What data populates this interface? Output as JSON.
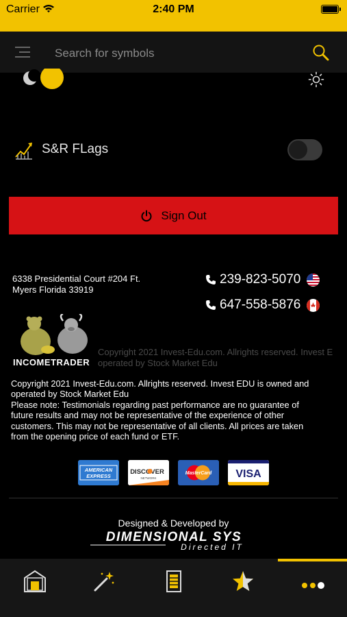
{
  "status_bar": {
    "carrier": "Carrier",
    "time": "2:40 PM"
  },
  "header": {
    "search_placeholder": "Search for symbols"
  },
  "settings": {
    "sr_flags_label": "S&R FLags",
    "sr_flags_enabled": false
  },
  "signout": {
    "label": "Sign Out"
  },
  "contact": {
    "address_line1": "6338 Presidential Court #204 Ft.",
    "address_line2": "Myers Florida 33919",
    "phone_us": "239-823-5070",
    "phone_ca": "647-558-5876"
  },
  "brand": {
    "logo_text": "INCOMETRADER",
    "copyright_faded_line1": "Copyright 2021 Invest-Edu.com. Allrights reserved. Invest E",
    "copyright_faded_line2": "operated by Stock Market Edu"
  },
  "footer": {
    "copyright_line1": "Copyright 2021 Invest-Edu.com. Allrights reserved. Invest EDU is owned and",
    "copyright_line2": "operated by Stock Market Edu",
    "note_line1": "Please note: Testimonials regarding past performance are no guarantee of",
    "note_line2": "future results and may not be representative of the experience of other",
    "note_line3": "customers. This may not be representative of all clients. All prices are taken",
    "note_line4": "from the opening price of each fund or ETF."
  },
  "payment_cards": {
    "amex_line1": "AMERICAN",
    "amex_line2": "EXPRESS",
    "discover": "DISCOVER",
    "discover_sub": "NETWORK",
    "mastercard": "MasterCard",
    "visa": "VISA"
  },
  "credits": {
    "designed_by": "Designed & Developed by",
    "company": "DIMENSIONAL SYS",
    "tagline": "Directed IT"
  },
  "tabs": {
    "active_index": 4,
    "items": [
      "home-icon",
      "magic-wand-icon",
      "notepad-icon",
      "star-icon",
      "more-dots-icon"
    ]
  },
  "colors": {
    "accent": "#f2c200",
    "signout_bg": "#d61215",
    "background": "#000000",
    "header_bg": "#141414",
    "tabbar_bg": "#161616"
  }
}
